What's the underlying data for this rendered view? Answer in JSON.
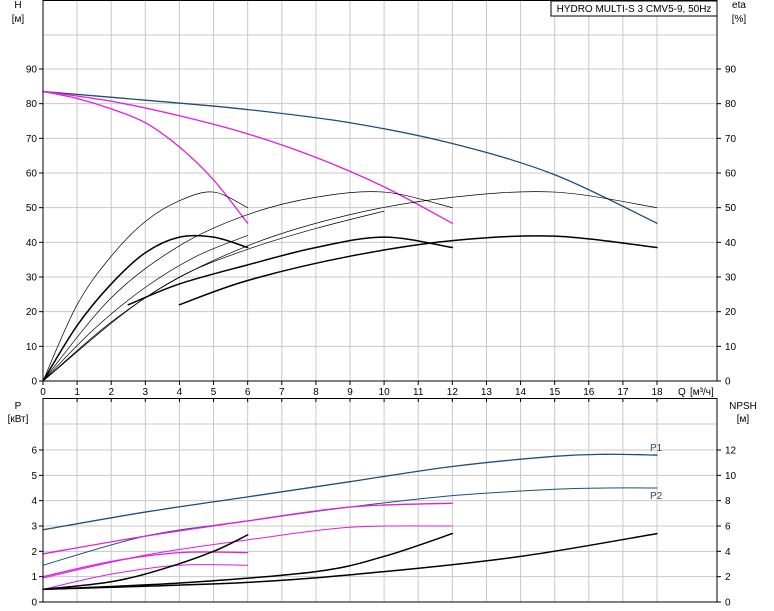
{
  "chart_data": [
    {
      "type": "line",
      "title": "HYDRO MULTI-S 3 CMV5-9, 50Hz",
      "xlabel": "Q [м³/ч]",
      "ylabel": "H [м]",
      "ylabel_right": "eta [%]",
      "xlim": [
        0,
        18
      ],
      "ylim": [
        0,
        100
      ],
      "x_ticks": [
        0,
        1,
        2,
        3,
        4,
        5,
        6,
        7,
        8,
        9,
        10,
        11,
        12,
        13,
        14,
        15,
        16,
        17,
        18
      ],
      "y_ticks": [
        0,
        10,
        20,
        30,
        40,
        50,
        60,
        70,
        80,
        90
      ],
      "grid": true,
      "series": [
        {
          "kind": "head",
          "color": "#1f4e79",
          "width": 1.3,
          "points": [
            [
              0,
              83.5
            ],
            [
              3,
              81
            ],
            [
              6,
              78.3
            ],
            [
              9,
              74.5
            ],
            [
              12,
              68.5
            ],
            [
              15,
              59.5
            ],
            [
              18,
              45.5
            ]
          ]
        },
        {
          "kind": "head",
          "color": "#e020e0",
          "width": 1.3,
          "points": [
            [
              0,
              83.5
            ],
            [
              2,
              80.7
            ],
            [
              4,
              76.5
            ],
            [
              6,
              71.3
            ],
            [
              8,
              64.5
            ],
            [
              10,
              56
            ],
            [
              12,
              45.5
            ]
          ]
        },
        {
          "kind": "head",
          "color": "#e020e0",
          "width": 1.3,
          "points": [
            [
              0,
              83.5
            ],
            [
              1,
              81.5
            ],
            [
              2,
              78.5
            ],
            [
              3,
              74.5
            ],
            [
              4,
              67.5
            ],
            [
              5,
              58
            ],
            [
              6,
              45.5
            ]
          ]
        },
        {
          "kind": "eta",
          "color": "#000000",
          "width": 0.7,
          "points": [
            [
              0,
              0
            ],
            [
              1,
              22
            ],
            [
              2,
              36
            ],
            [
              3,
              46
            ],
            [
              4,
              52
            ],
            [
              5,
              54.5
            ],
            [
              6,
              50
            ]
          ]
        },
        {
          "kind": "eta",
          "color": "#000000",
          "width": 0.7,
          "points": [
            [
              0,
              0
            ],
            [
              2,
              24
            ],
            [
              4,
              39
            ],
            [
              6,
              48
            ],
            [
              8,
              53
            ],
            [
              10,
              54.5
            ],
            [
              12,
              50
            ]
          ]
        },
        {
          "kind": "eta",
          "color": "#000000",
          "width": 0.7,
          "points": [
            [
              0,
              0
            ],
            [
              3,
              24
            ],
            [
              6,
              39
            ],
            [
              9,
              48
            ],
            [
              12,
              53
            ],
            [
              15,
              54.5
            ],
            [
              18,
              50
            ]
          ]
        },
        {
          "kind": "eta",
          "color": "#000000",
          "width": 0.7,
          "points": [
            [
              0,
              0
            ],
            [
              1.5,
              15
            ],
            [
              3,
              27
            ],
            [
              4.5,
              36
            ],
            [
              6,
              42
            ]
          ]
        },
        {
          "kind": "eta",
          "color": "#000000",
          "width": 0.7,
          "points": [
            [
              0,
              0
            ],
            [
              2,
              17
            ],
            [
              4,
              30
            ],
            [
              6,
              38
            ],
            [
              8,
              44
            ],
            [
              10,
              49
            ]
          ]
        },
        {
          "kind": "eta",
          "color": "#000000",
          "width": 1.5,
          "points": [
            [
              0,
              0
            ],
            [
              1,
              16
            ],
            [
              2,
              28
            ],
            [
              3,
              37
            ],
            [
              4,
              41.5
            ],
            [
              5,
              41.5
            ],
            [
              6,
              38.5
            ]
          ]
        },
        {
          "kind": "eta",
          "color": "#000000",
          "width": 1.5,
          "points": [
            [
              2.5,
              22
            ],
            [
              4,
              28
            ],
            [
              6,
              33.5
            ],
            [
              8,
              38.5
            ],
            [
              10,
              41.5
            ],
            [
              12,
              38.5
            ]
          ]
        },
        {
          "kind": "eta",
          "color": "#000000",
          "width": 1.5,
          "points": [
            [
              4,
              22
            ],
            [
              6,
              29
            ],
            [
              9,
              36
            ],
            [
              12,
              40.5
            ],
            [
              15,
              41.8
            ],
            [
              18,
              38.5
            ]
          ]
        }
      ]
    },
    {
      "type": "line",
      "xlim": [
        0,
        18
      ],
      "ylabel": "P [кВт]",
      "ylabel_right": "NPSH [м]",
      "ylim": [
        0,
        7
      ],
      "ylim_right": [
        0,
        14
      ],
      "y_ticks": [
        0,
        1,
        2,
        3,
        4,
        5,
        6
      ],
      "y_ticks_right": [
        0,
        2,
        4,
        6,
        8,
        10,
        12
      ],
      "grid": true,
      "series": [
        {
          "name": "P1",
          "kind": "power",
          "color": "#1f4e79",
          "width": 1.3,
          "points": [
            [
              0,
              2.85
            ],
            [
              3,
              3.55
            ],
            [
              6,
              4.15
            ],
            [
              9,
              4.75
            ],
            [
              12,
              5.35
            ],
            [
              15,
              5.75
            ],
            [
              16.5,
              5.83
            ],
            [
              18,
              5.8
            ]
          ]
        },
        {
          "name": "P2",
          "kind": "power",
          "color": "#1f4e79",
          "width": 1.0,
          "points": [
            [
              0,
              1.45
            ],
            [
              3,
              2.6
            ],
            [
              6,
              3.2
            ],
            [
              9,
              3.75
            ],
            [
              12,
              4.2
            ],
            [
              15,
              4.45
            ],
            [
              16.5,
              4.5
            ],
            [
              18,
              4.5
            ]
          ]
        },
        {
          "kind": "power",
          "color": "#e020e0",
          "width": 1.3,
          "points": [
            [
              0,
              1.9
            ],
            [
              3,
              2.6
            ],
            [
              6,
              3.2
            ],
            [
              9,
              3.75
            ],
            [
              12,
              3.9
            ]
          ]
        },
        {
          "kind": "power",
          "color": "#e020e0",
          "width": 1.0,
          "points": [
            [
              0,
              0.95
            ],
            [
              3,
              1.85
            ],
            [
              6,
              2.45
            ],
            [
              9,
              2.95
            ],
            [
              12,
              3.0
            ]
          ]
        },
        {
          "kind": "power",
          "color": "#e020e0",
          "width": 1.3,
          "points": [
            [
              0,
              1.0
            ],
            [
              2,
              1.6
            ],
            [
              4,
              1.95
            ],
            [
              6,
              1.95
            ]
          ]
        },
        {
          "kind": "power",
          "color": "#e020e0",
          "width": 1.0,
          "points": [
            [
              0,
              0.5
            ],
            [
              2,
              1.1
            ],
            [
              4,
              1.45
            ],
            [
              6,
              1.45
            ]
          ]
        },
        {
          "kind": "npsh",
          "color": "#000000",
          "width": 1.5,
          "points": [
            [
              0,
              1.0
            ],
            [
              2,
              1.6
            ],
            [
              3.5,
              2.6
            ],
            [
              5,
              4.0
            ],
            [
              6,
              5.3
            ]
          ]
        },
        {
          "kind": "npsh",
          "color": "#000000",
          "width": 1.5,
          "points": [
            [
              0,
              1.0
            ],
            [
              4,
              1.5
            ],
            [
              8,
              2.4
            ],
            [
              10,
              3.6
            ],
            [
              12,
              5.4
            ]
          ]
        },
        {
          "kind": "npsh",
          "color": "#000000",
          "width": 1.5,
          "points": [
            [
              0,
              1.0
            ],
            [
              6,
              1.55
            ],
            [
              10,
              2.4
            ],
            [
              14,
              3.6
            ],
            [
              18,
              5.4
            ]
          ]
        }
      ]
    }
  ]
}
